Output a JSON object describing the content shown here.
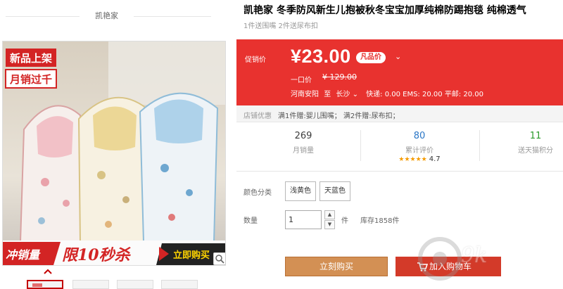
{
  "shop": {
    "name": "凯艳家"
  },
  "product": {
    "title": "凯艳家 冬季防风新生儿抱被秋冬宝宝加厚纯棉防踢抱毯 纯棉透气",
    "subtitle": "1件送围嘴 2件送尿布扣"
  },
  "banner": {
    "tag_new": "新品上架",
    "tag_hot": "月销过千",
    "bottom_left": "冲销量",
    "bottom_mid": "限10秒杀",
    "bottom_right": "立即购买"
  },
  "price": {
    "label": "促销价",
    "current": "¥23.00",
    "badge": "凡品价",
    "original_label": "一口价",
    "original": "¥ 129.00",
    "origin": "河南安阳",
    "to_word": "至",
    "destination": "长沙",
    "shipping": "快递: 0.00 EMS: 20.00 平邮: 20.00"
  },
  "promo": {
    "label": "店铺优惠",
    "text": "满1件赠:婴儿围嘴； 满2件赠:尿布扣；"
  },
  "stats": {
    "sales_num": "269",
    "sales_label": "月销量",
    "reviews_num": "80",
    "reviews_label": "累计评价",
    "stars": "★★★★★",
    "score": "4.7",
    "points_num": "11",
    "points_label": "送天猫积分"
  },
  "options": {
    "color_label": "颜色分类",
    "colors": [
      "浅黄色",
      "天蓝色"
    ],
    "qty_label": "数量",
    "qty_value": "1",
    "unit": "件",
    "stock": "库存1858件"
  },
  "actions": {
    "buy_now": "立刻购买",
    "add_cart": "加入购物车"
  },
  "watermark": {
    "text": "9k"
  },
  "colors": {
    "accent": "#e8322f",
    "buy": "#d39054",
    "cart": "#d33a29"
  }
}
